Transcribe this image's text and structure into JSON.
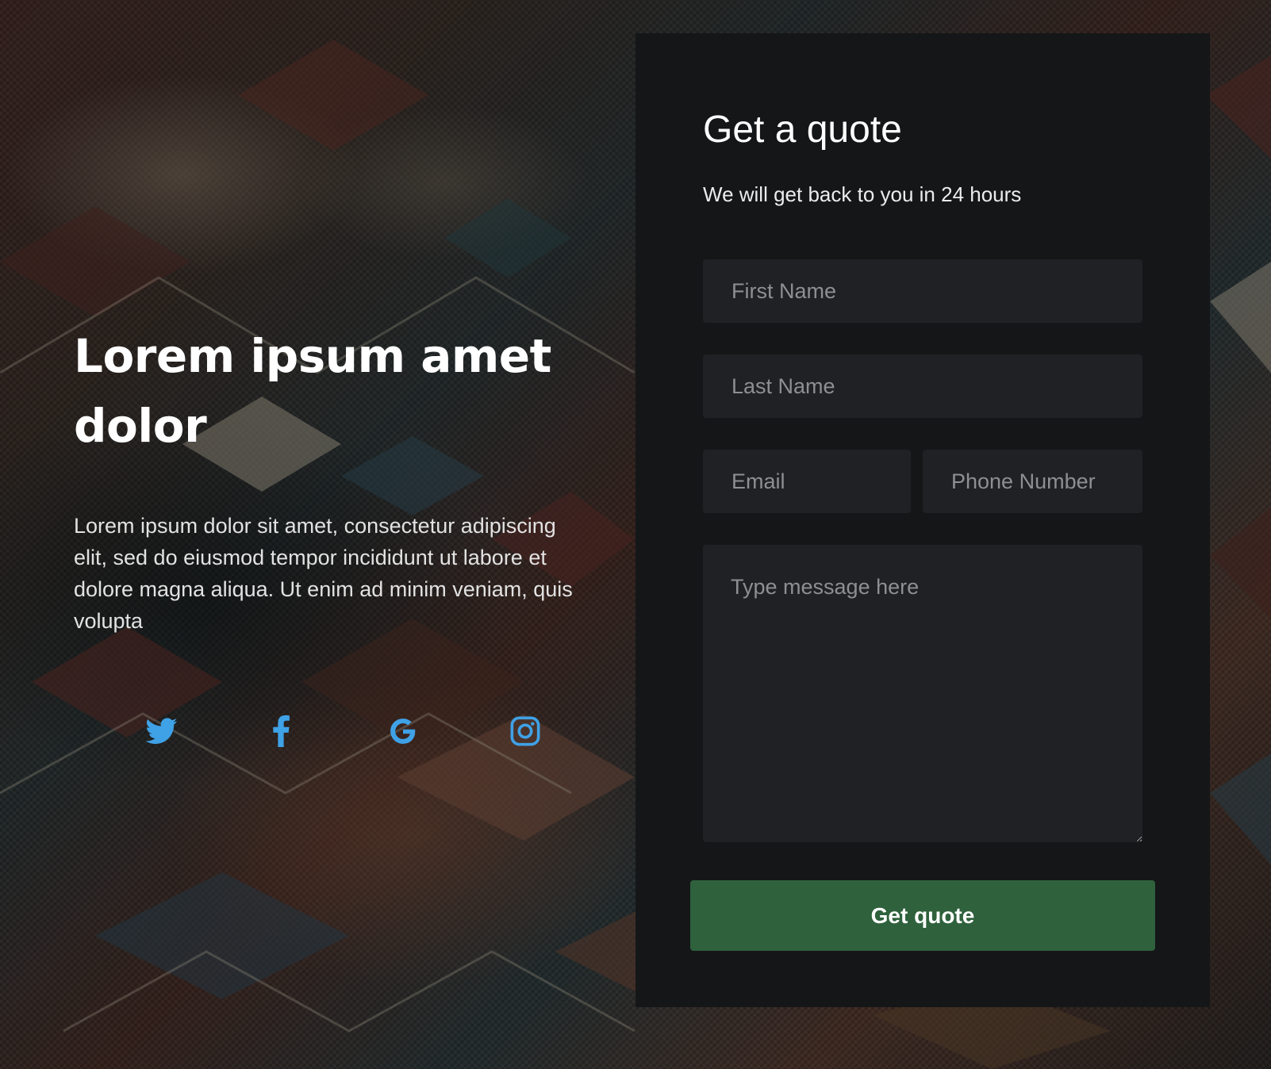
{
  "hero": {
    "heading": "Lorem ipsum amet dolor",
    "body": "Lorem ipsum dolor sit amet, consectetur adipiscing elit, sed do eiusmod tempor incididunt ut labore et dolore magna aliqua. Ut enim ad minim veniam, quis volupta"
  },
  "socials": [
    {
      "icon": "twitter-icon",
      "color": "#3fa1e6"
    },
    {
      "icon": "facebook-icon",
      "color": "#3fa1e6"
    },
    {
      "icon": "google-icon",
      "color": "#3fa1e6"
    },
    {
      "icon": "instagram-icon",
      "color": "#3fa1e6"
    }
  ],
  "form": {
    "title": "Get a quote",
    "subtitle": "We will get back to you in 24 hours",
    "first_name_placeholder": "First Name",
    "last_name_placeholder": "Last Name",
    "email_placeholder": "Email",
    "phone_placeholder": "Phone Number",
    "message_placeholder": "Type message here",
    "submit_label": "Get quote"
  },
  "colors": {
    "card_background": "#151618",
    "field_background": "#202124",
    "button_background": "#2e613c",
    "icon_accent": "#3fa1e6"
  }
}
